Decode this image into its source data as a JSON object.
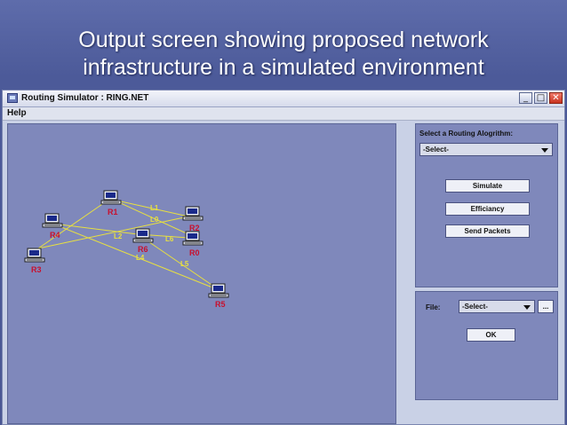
{
  "slide": {
    "title_line1": "Output screen showing proposed network",
    "title_line2": "infrastructure in a simulated environment"
  },
  "window": {
    "title": "Routing Simulator  : RING.NET",
    "minimize_glyph": "_",
    "maximize_glyph": "□",
    "close_glyph": "✕"
  },
  "menu": {
    "help": "Help"
  },
  "network": {
    "nodes": [
      "R1",
      "R2",
      "R0",
      "R6",
      "R4",
      "R3",
      "R5"
    ],
    "links": [
      "L1",
      "L0",
      "L2",
      "L6",
      "L4",
      "L5"
    ],
    "label_color": "#c8102e",
    "link_color": "#e8e040"
  },
  "routing_panel": {
    "algorithm_label": "Select a Routing Alogrithm:",
    "algorithm_value": "-Select-",
    "simulate_label": "Simulate",
    "efficiency_label": "Efficiancy",
    "send_label": "Send Packets"
  },
  "file_panel": {
    "file_label": "File:",
    "file_value": "-Select-",
    "browse_label": "...",
    "ok_label": "OK"
  }
}
